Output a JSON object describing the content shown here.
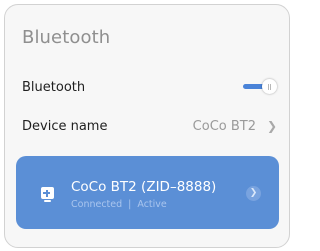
{
  "page": {
    "title": "Bluetooth"
  },
  "bluetooth_row": {
    "label": "Bluetooth",
    "enabled": true
  },
  "device_name_row": {
    "label": "Device name",
    "value": "CoCo BT2",
    "chevron_icon": "chevron-right-icon"
  },
  "device_card": {
    "name": "CoCo BT2 (ZID–8888)",
    "status": "Connected",
    "separator": "|",
    "state": "Active",
    "device_icon": "tv-plus-icon",
    "detail_icon": "chevron-right-icon",
    "color": "#5b8fd6"
  },
  "colors": {
    "accent": "#4a83d8",
    "background": "#f7f7f7"
  }
}
